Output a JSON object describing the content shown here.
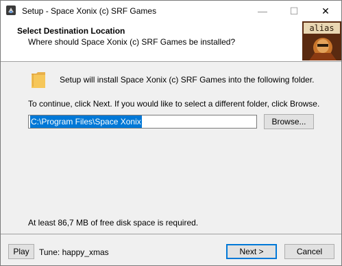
{
  "window": {
    "title": "Setup - Space Xonix (c) SRF Games",
    "minimize_glyph": "—",
    "maximize_glyph": "☐",
    "close_glyph": "✕"
  },
  "header": {
    "title": "Select Destination Location",
    "subtitle": "Where should Space Xonix (c) SRF Games be installed?",
    "logo_text": "alias"
  },
  "body": {
    "install_text": "Setup will install Space Xonix (c) SRF Games into the following folder.",
    "instruction_text": "To continue, click Next. If you would like to select a different folder, click Browse.",
    "path_value": "C:\\Program Files\\Space Xonix",
    "browse_label": "Browse...",
    "disk_space_text": "At least 86,7 MB of free disk space is required."
  },
  "footer": {
    "play_label": "Play",
    "tune_text": "Tune: happy_xmas",
    "next_label": "Next >",
    "cancel_label": "Cancel"
  },
  "icons": {
    "app": "setup-app-icon",
    "folder": "folder-icon"
  },
  "colors": {
    "accent": "#0078d7",
    "folder": "#f6c75a"
  }
}
